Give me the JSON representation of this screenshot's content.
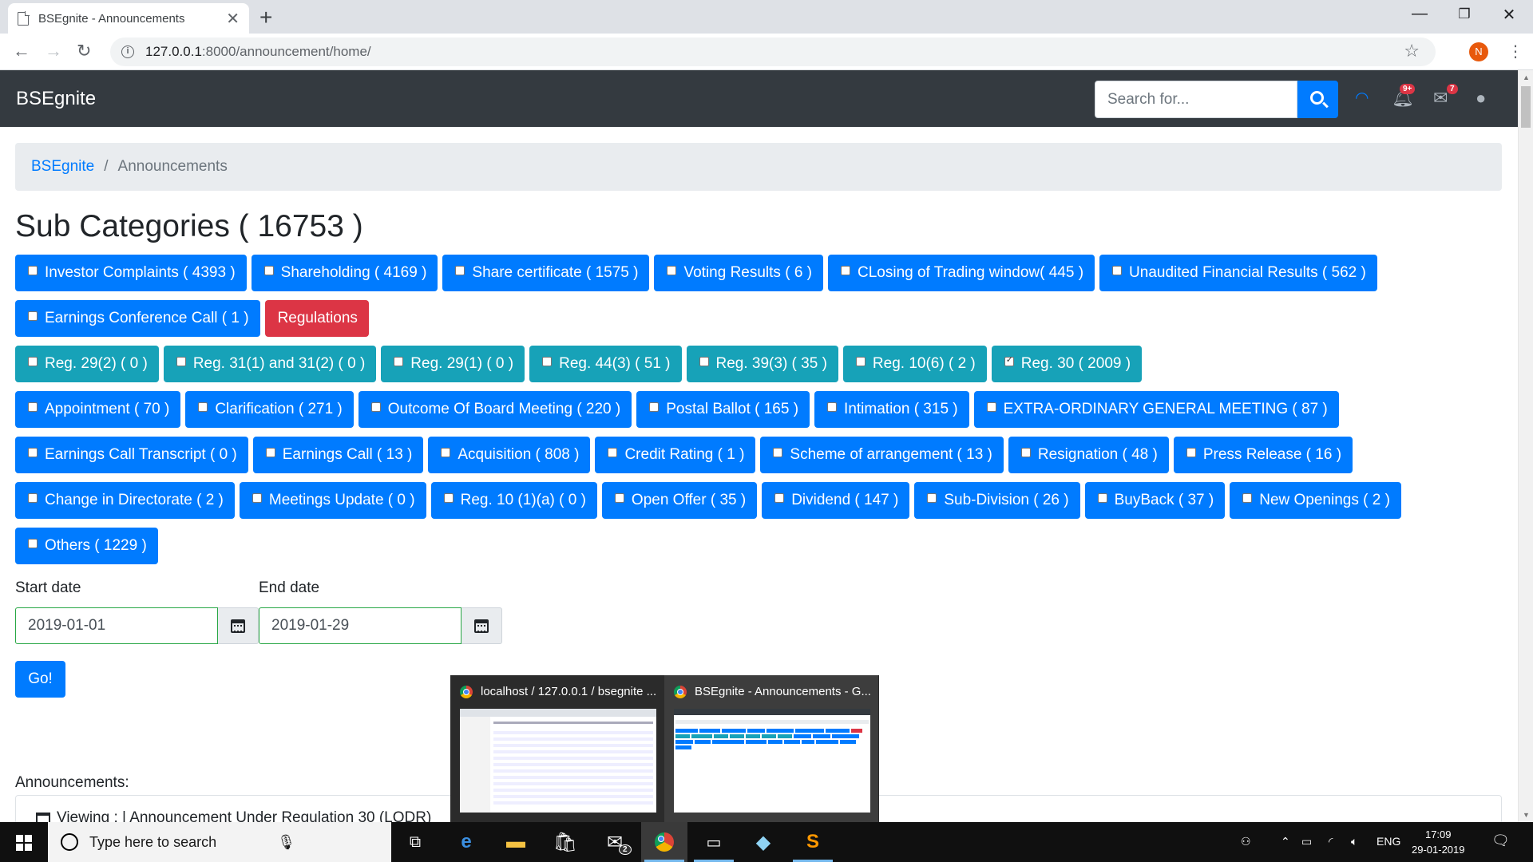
{
  "browser": {
    "tab_title": "BSEgnite - Announcements",
    "url_host": "127.0.0.1",
    "url_path": ":8000/announcement/home/",
    "profile_initial": "N"
  },
  "navbar": {
    "brand": "BSEgnite",
    "search_placeholder": "Search for...",
    "alerts_badge": "9+",
    "messages_badge": "7"
  },
  "breadcrumb": {
    "home": "BSEgnite",
    "current": "Announcements"
  },
  "heading": "Sub Categories ( 16753 )",
  "rows": [
    [
      {
        "label": "Investor Complaints ( 4393 )",
        "color": "blue",
        "checkbox": true,
        "checked": false
      },
      {
        "label": "Shareholding ( 4169 )",
        "color": "blue",
        "checkbox": true,
        "checked": false
      },
      {
        "label": "Share certificate ( 1575 )",
        "color": "blue",
        "checkbox": true,
        "checked": false
      },
      {
        "label": "Voting Results ( 6 )",
        "color": "blue",
        "checkbox": true,
        "checked": false
      },
      {
        "label": "CLosing of Trading window( 445 )",
        "color": "blue",
        "checkbox": true,
        "checked": false
      },
      {
        "label": "Unaudited Financial Results ( 562 )",
        "color": "blue",
        "checkbox": true,
        "checked": false
      }
    ],
    [
      {
        "label": "Earnings Conference Call ( 1 )",
        "color": "blue",
        "checkbox": true,
        "checked": false
      },
      {
        "label": "Regulations",
        "color": "red",
        "checkbox": false,
        "checked": false
      }
    ],
    [
      {
        "label": "Reg. 29(2) ( 0 )",
        "color": "teal",
        "checkbox": true,
        "checked": false
      },
      {
        "label": "Reg. 31(1) and 31(2) ( 0 )",
        "color": "teal",
        "checkbox": true,
        "checked": false
      },
      {
        "label": "Reg. 29(1) ( 0 )",
        "color": "teal",
        "checkbox": true,
        "checked": false
      },
      {
        "label": "Reg. 44(3) ( 51 )",
        "color": "teal",
        "checkbox": true,
        "checked": false
      },
      {
        "label": "Reg. 39(3) ( 35 )",
        "color": "teal",
        "checkbox": true,
        "checked": false
      },
      {
        "label": "Reg. 10(6) ( 2 )",
        "color": "teal",
        "checkbox": true,
        "checked": false
      },
      {
        "label": "Reg. 30 ( 2009 )",
        "color": "teal",
        "checkbox": true,
        "checked": true
      }
    ],
    [
      {
        "label": "Appointment ( 70 )",
        "color": "blue",
        "checkbox": true,
        "checked": false
      },
      {
        "label": "Clarification ( 271 )",
        "color": "blue",
        "checkbox": true,
        "checked": false
      },
      {
        "label": "Outcome Of Board Meeting ( 220 )",
        "color": "blue",
        "checkbox": true,
        "checked": false
      },
      {
        "label": "Postal Ballot ( 165 )",
        "color": "blue",
        "checkbox": true,
        "checked": false
      },
      {
        "label": "Intimation ( 315 )",
        "color": "blue",
        "checkbox": true,
        "checked": false
      },
      {
        "label": "EXTRA-ORDINARY GENERAL MEETING ( 87 )",
        "color": "blue",
        "checkbox": true,
        "checked": false
      }
    ],
    [
      {
        "label": "Earnings Call Transcript ( 0 )",
        "color": "blue",
        "checkbox": true,
        "checked": false
      },
      {
        "label": "Earnings Call ( 13 )",
        "color": "blue",
        "checkbox": true,
        "checked": false
      },
      {
        "label": "Acquisition ( 808 )",
        "color": "blue",
        "checkbox": true,
        "checked": false
      },
      {
        "label": "Credit Rating ( 1 )",
        "color": "blue",
        "checkbox": true,
        "checked": false
      },
      {
        "label": "Scheme of arrangement ( 13 )",
        "color": "blue",
        "checkbox": true,
        "checked": false
      },
      {
        "label": "Resignation ( 48 )",
        "color": "blue",
        "checkbox": true,
        "checked": false
      },
      {
        "label": "Press Release ( 16 )",
        "color": "blue",
        "checkbox": true,
        "checked": false
      }
    ],
    [
      {
        "label": "Change in Directorate ( 2 )",
        "color": "blue",
        "checkbox": true,
        "checked": false
      },
      {
        "label": "Meetings Update ( 0 )",
        "color": "blue",
        "checkbox": true,
        "checked": false
      },
      {
        "label": "Reg. 10 (1)(a) ( 0 )",
        "color": "blue",
        "checkbox": true,
        "checked": false
      },
      {
        "label": "Open Offer ( 35 )",
        "color": "blue",
        "checkbox": true,
        "checked": false
      },
      {
        "label": "Dividend ( 147 )",
        "color": "blue",
        "checkbox": true,
        "checked": false
      },
      {
        "label": "Sub-Division ( 26 )",
        "color": "blue",
        "checkbox": true,
        "checked": false
      },
      {
        "label": "BuyBack ( 37 )",
        "color": "blue",
        "checkbox": true,
        "checked": false
      },
      {
        "label": "New Openings ( 2 )",
        "color": "blue",
        "checkbox": true,
        "checked": false
      }
    ],
    [
      {
        "label": "Others ( 1229 )",
        "color": "blue",
        "checkbox": true,
        "checked": false
      }
    ]
  ],
  "dates": {
    "start_label": "Start date",
    "start_value": "2019-01-01",
    "end_label": "End date",
    "end_value": "2019-01-29",
    "go_label": "Go!"
  },
  "announcements": {
    "label": "Announcements:",
    "card_header": "Viewing : | Announcement Under Regulation 30 (LODR)"
  },
  "thumbnails": [
    {
      "title": "localhost / 127.0.0.1 / bsegnite ..."
    },
    {
      "title": "BSEgnite - Announcements - G..."
    }
  ],
  "taskbar": {
    "search_placeholder": "Type here to search",
    "mail_badge": "2",
    "lang": "ENG",
    "time": "17:09",
    "date": "29-01-2019"
  },
  "colors": {
    "blue": "#007bff",
    "teal": "#17a2b8",
    "red": "#dc3545",
    "navbar": "#343a40"
  }
}
